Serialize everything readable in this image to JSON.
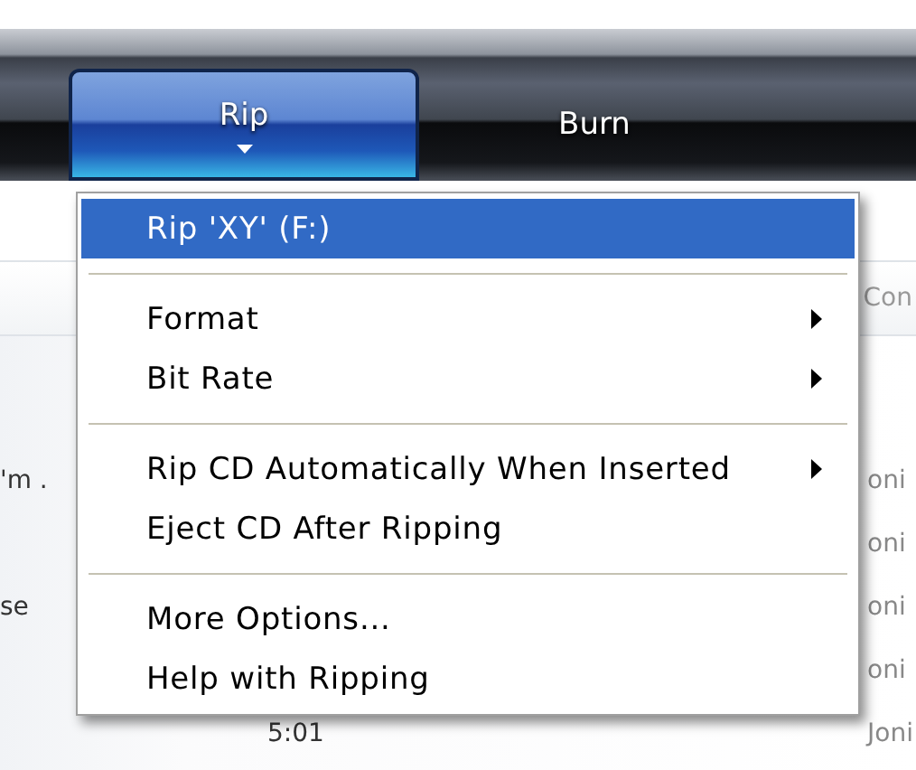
{
  "tabs": [
    {
      "label": "Rip",
      "selected": true
    },
    {
      "label": "Burn",
      "selected": false
    }
  ],
  "track_list": {
    "header": {
      "column_3": "Con"
    },
    "rows": [
      {
        "column_1": "'m .",
        "column_3": "oni"
      },
      {
        "column_3": "oni"
      },
      {
        "column_1": "se",
        "column_3": "oni"
      },
      {
        "column_3": "oni"
      },
      {
        "column_2": "5:01",
        "column_3": "Joni"
      }
    ]
  },
  "menu": {
    "groups": [
      [
        {
          "label": "Rip 'XY' (F:)",
          "selected": true,
          "has_submenu": false
        }
      ],
      [
        {
          "label": "Format",
          "selected": false,
          "has_submenu": true
        },
        {
          "label": "Bit Rate",
          "selected": false,
          "has_submenu": true
        }
      ],
      [
        {
          "label": "Rip CD Automatically When Inserted",
          "selected": false,
          "has_submenu": true
        },
        {
          "label": "Eject CD After Ripping",
          "selected": false,
          "has_submenu": false
        }
      ],
      [
        {
          "label": "More Options...",
          "selected": false,
          "has_submenu": false
        },
        {
          "label": "Help with Ripping",
          "selected": false,
          "has_submenu": false
        }
      ]
    ]
  }
}
